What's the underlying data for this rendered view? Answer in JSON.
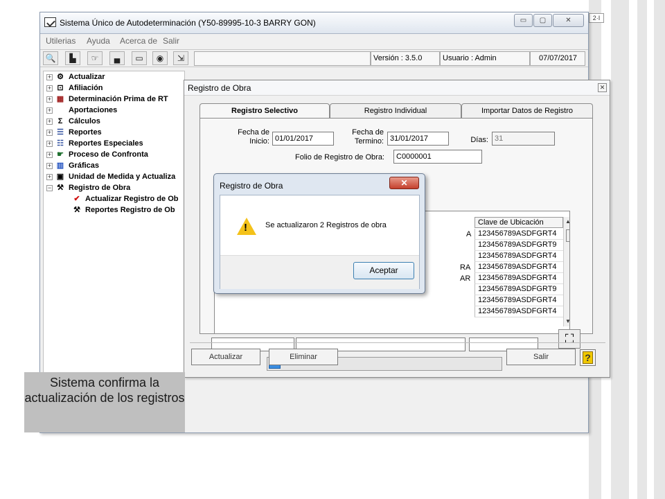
{
  "main_window": {
    "title": "Sistema Único de Autodeterminación (Y50-89995-10-3  BARRY GON)",
    "min_glyph": "▭",
    "max_glyph": "▢",
    "close_glyph": "✕"
  },
  "side_tag": "2·I",
  "menu": [
    "Utilerias",
    "Ayuda",
    "Acerca de",
    "Salir"
  ],
  "toolbar": {
    "version": "Versión : 3.5.0",
    "user": "Usuario : Admin",
    "date": "07/07/2017",
    "icons": [
      "search-icon",
      "building-icon",
      "hand-icon",
      "save-icon",
      "eraser-icon",
      "globe-icon",
      "exit-icon"
    ]
  },
  "tree": {
    "items": [
      {
        "label": "Actualizar",
        "icon": "update-icon",
        "exp": "+"
      },
      {
        "label": "Afiliación",
        "icon": "affiliation-icon",
        "exp": "+"
      },
      {
        "label": "Determinación Prima de RT",
        "icon": "chart-icon",
        "exp": "+"
      },
      {
        "label": "Aportaciones",
        "icon": "blank-icon",
        "exp": "+"
      },
      {
        "label": "Cálculos",
        "icon": "sigma-icon",
        "exp": "+"
      },
      {
        "label": "Reportes",
        "icon": "reports-icon",
        "exp": "+"
      },
      {
        "label": "Reportes Especiales",
        "icon": "special-reports-icon",
        "exp": "+"
      },
      {
        "label": "Proceso de Confronta",
        "icon": "confront-icon",
        "exp": "+"
      },
      {
        "label": "Gráficas",
        "icon": "bar-chart-icon",
        "exp": "+"
      },
      {
        "label": "Unidad de Medida y Actualiza",
        "icon": "calculator-icon",
        "exp": "+"
      },
      {
        "label": "Registro de Obra",
        "icon": "tools-icon",
        "exp": "−"
      }
    ],
    "children": [
      {
        "label": "Actualizar Registro de Ob",
        "icon": "checkmark-icon"
      },
      {
        "label": "Reportes Registro de Ob",
        "icon": "tools-icon"
      }
    ]
  },
  "caption": "Sistema confirma la actualización de los registros",
  "child_window": {
    "title": "Registro de Obra",
    "close_glyph": "✕",
    "tabs": [
      "Registro Selectivo",
      "Registro Individual",
      "Importar Datos de Registro"
    ],
    "fecha_inicio_label_1": "Fecha de",
    "fecha_inicio_label_2": "Inicio:",
    "fecha_inicio": "01/01/2017",
    "fecha_termino_label_1": "Fecha de",
    "fecha_termino_label_2": "Termino:",
    "fecha_termino": "31/01/2017",
    "dias_label": "Días:",
    "dias": "31",
    "folio_label": "Folio de Registro de Obra:",
    "folio": "C0000001",
    "grid_header": "Clave de Ubicación",
    "grid_rows": [
      "123456789ASDFGRT4",
      "123456789ASDFGRT9",
      "123456789ASDFGRT4",
      "123456789ASDFGRT4",
      "123456789ASDFGRT4",
      "123456789ASDFGRT9",
      "123456789ASDFGRT4",
      "123456789ASDFGRT4"
    ],
    "grid_fragments": [
      "A",
      "RA",
      "AR"
    ],
    "progress": 0.05,
    "btn_actualizar": "Actualizar",
    "btn_eliminar": "Eliminar",
    "btn_salir": "Salir",
    "help_glyph": "?",
    "binoculars_glyph": "👁"
  },
  "dialog": {
    "title": "Registro de Obra",
    "close_glyph": "✕",
    "message": "Se actualizaron 2 Registros de obra",
    "ok": "Aceptar",
    "warn_glyph": "!"
  },
  "colors": {
    "accent": "#3b8de0",
    "dialog_close": "#c5402c",
    "warning": "#f4c21a"
  }
}
